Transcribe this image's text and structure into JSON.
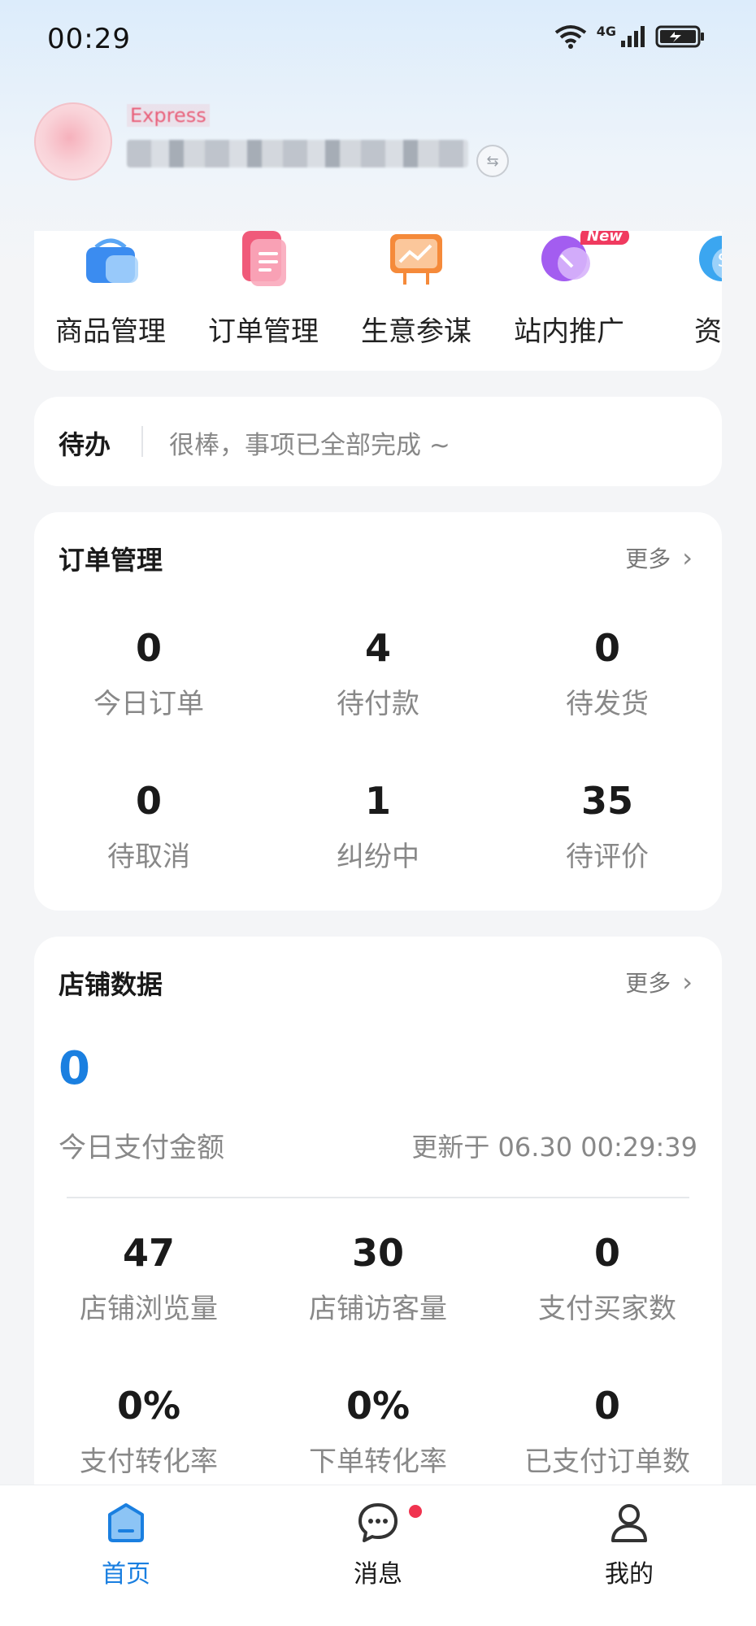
{
  "status_bar": {
    "time": "00:29",
    "icons": [
      "wifi-6-icon",
      "signal-4g-icon",
      "battery-charging-icon"
    ],
    "network_label": "4G"
  },
  "header": {
    "store_name": "Express",
    "switch_icon": "switch-arrows-icon"
  },
  "quick_actions": [
    {
      "label": "商品管理",
      "icon": "shopping-bag-icon",
      "color": "#3b8cf0"
    },
    {
      "label": "订单管理",
      "icon": "document-icon",
      "color": "#f05a7a"
    },
    {
      "label": "生意参谋",
      "icon": "chart-board-icon",
      "color": "#f58a3a"
    },
    {
      "label": "站内推广",
      "icon": "promotion-icon",
      "color": "#a35df0",
      "badge": "New"
    },
    {
      "label": "资金",
      "icon": "funds-icon",
      "color": "#3ba6f0"
    }
  ],
  "todo": {
    "title": "待办",
    "message": "很棒，事项已全部完成 ~"
  },
  "order_management": {
    "title": "订单管理",
    "more": "更多",
    "stats": [
      {
        "value": "0",
        "label": "今日订单"
      },
      {
        "value": "4",
        "label": "待付款"
      },
      {
        "value": "0",
        "label": "待发货"
      },
      {
        "value": "0",
        "label": "待取消"
      },
      {
        "value": "1",
        "label": "纠纷中"
      },
      {
        "value": "35",
        "label": "待评价"
      }
    ]
  },
  "store_data": {
    "title": "店铺数据",
    "more": "更多",
    "pay_amount": "0",
    "pay_label": "今日支付金额",
    "updated_at": "更新于 06.30 00:29:39",
    "stats": [
      {
        "value": "47",
        "label": "店铺浏览量"
      },
      {
        "value": "30",
        "label": "店铺访客量"
      },
      {
        "value": "0",
        "label": "支付买家数"
      },
      {
        "value": "0%",
        "label": "支付转化率"
      },
      {
        "value": "0%",
        "label": "下单转化率"
      },
      {
        "value": "0",
        "label": "已支付订单数"
      }
    ]
  },
  "bottom_nav": {
    "home": "首页",
    "messages": "消息",
    "me": "我的",
    "accent": "#1a7fe0"
  }
}
